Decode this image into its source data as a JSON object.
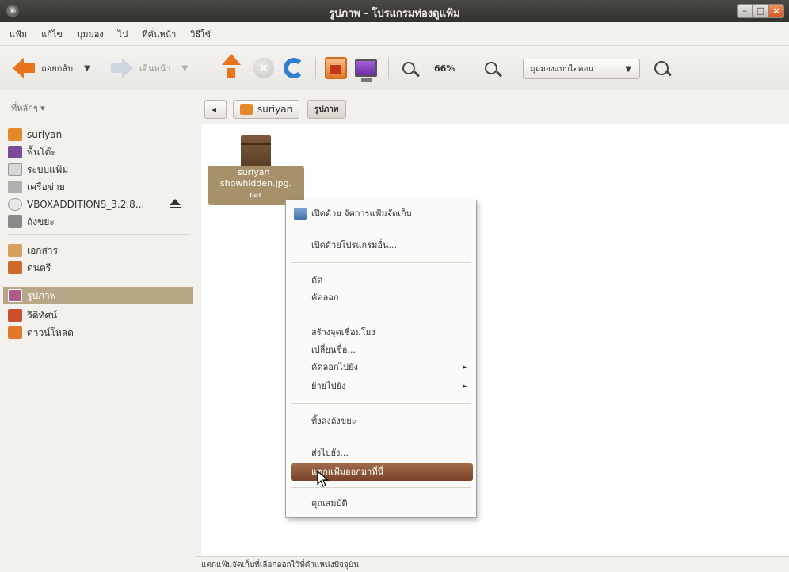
{
  "window": {
    "title": "รูปภาพ - โปรแกรมท่องดูแฟ้ม"
  },
  "menubar": [
    "แฟ้ม",
    "แก้ไข",
    "มุมมอง",
    "ไป",
    "ที่คั่นหน้า",
    "วิธีใช้"
  ],
  "toolbar": {
    "back_label": "ถอยกลับ",
    "forward_label": "เดินหน้า",
    "zoom_level": "66%",
    "view_mode": "มุมมองแบบไอคอน"
  },
  "sidebar": {
    "header": "ที่หลักๆ ▾",
    "items": [
      {
        "label": "suriyan",
        "icon": "home-folder-icon",
        "color": "#e4882c"
      },
      {
        "label": "พื้นโต๊ะ",
        "icon": "desktop-icon",
        "color": "#7a4a9a"
      },
      {
        "label": "ระบบแฟ้ม",
        "icon": "filesystem-icon",
        "color": "#9a9a9a"
      },
      {
        "label": "เครือข่าย",
        "icon": "network-icon",
        "color": "#b0b0b0"
      },
      {
        "label": "VBOXADDITIONS_3.2.8...",
        "icon": "cdrom-icon",
        "color": "#c8c8c8"
      },
      {
        "label": "ถังขยะ",
        "icon": "trash-icon",
        "color": "#8a8a8a"
      },
      {
        "label": "เอกสาร",
        "icon": "documents-folder-icon",
        "color": "#d8a060"
      },
      {
        "label": "ดนตรี",
        "icon": "music-folder-icon",
        "color": "#d06a2a"
      },
      {
        "label": "รูปภาพ",
        "icon": "pictures-folder-icon",
        "color": "#b05a8a"
      },
      {
        "label": "วีดิทัศน์",
        "icon": "videos-folder-icon",
        "color": "#c8502a"
      },
      {
        "label": "ดาวน์โหลด",
        "icon": "downloads-folder-icon",
        "color": "#e07a2a"
      }
    ]
  },
  "location": {
    "crumbs": [
      "suriyan",
      "รูปภาพ"
    ]
  },
  "file": {
    "label_lines": [
      "suriyan_",
      "showhidden.jpg.",
      "rar"
    ]
  },
  "context_menu": [
    {
      "label": "เปิดด้วย จัดการแฟ้มจัดเก็บ",
      "icon": "archive-manager-icon"
    },
    {
      "sep": true
    },
    {
      "label": "เปิดด้วยโปรแกรมอื่น..."
    },
    {
      "sep": true
    },
    {
      "label": "ตัด"
    },
    {
      "label": "คัดลอก"
    },
    {
      "sep": true
    },
    {
      "label": "สร้างจุดเชื่อมโยง"
    },
    {
      "label": "เปลี่ยนชื่อ..."
    },
    {
      "label": "คัดลอกไปยัง",
      "submenu": true
    },
    {
      "label": "ย้ายไปยัง",
      "submenu": true
    },
    {
      "sep": true
    },
    {
      "label": "ทิ้งลงถังขยะ"
    },
    {
      "sep": true
    },
    {
      "label": "ส่งไปยัง..."
    },
    {
      "label": "แตกแฟ้มออกมาที่นี่",
      "highlighted": true
    },
    {
      "sep": true
    },
    {
      "label": "คุณสมบัติ"
    }
  ],
  "status_text": "แตกแฟ้มจัดเก็บที่เลือกออกไว้ที่ตำแหน่งปัจจุบัน",
  "colors": {
    "accent": "#e9741c",
    "selection": "#b8a787",
    "menu_highlight": "#8a4f32"
  }
}
